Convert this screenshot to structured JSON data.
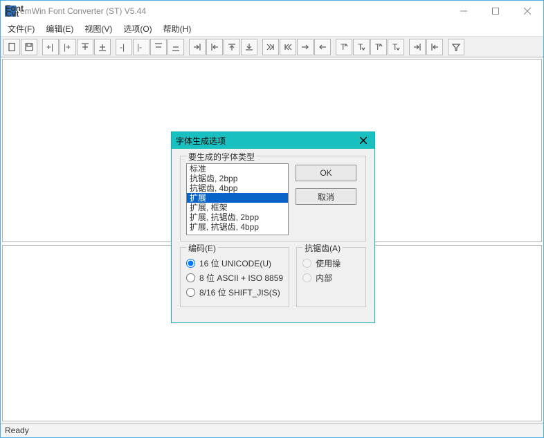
{
  "window": {
    "title": "emWin Font Converter (ST) V5.44",
    "appicon_top": "Font",
    "appicon_bot": "Cvt"
  },
  "menu": {
    "file": "文件(F)",
    "edit": "编辑(E)",
    "view": "视图(V)",
    "options": "选项(O)",
    "help": "帮助(H)"
  },
  "status": {
    "text": "Ready"
  },
  "dialog": {
    "title": "字体生成选项",
    "group_fonttype": "要生成的字体类型",
    "list": {
      "i0": "标准",
      "i1": "抗锯齿, 2bpp",
      "i2": "抗锯齿, 4bpp",
      "i3": "扩展",
      "i4": "扩展, 框架",
      "i5": "扩展, 抗锯齿, 2bpp",
      "i6": "扩展, 抗锯齿, 4bpp"
    },
    "selected_index": 3,
    "ok": "OK",
    "cancel": "取消",
    "group_encoding": "编码(E)",
    "enc_unicode": "16 位 UNICODE(U)",
    "enc_ascii": "8 位 ASCII + ISO 8859",
    "enc_sjis": "8/16 位 SHIFT_JIS(S)",
    "group_aa": "抗锯齿(A)",
    "aa_use": "使用操",
    "aa_internal": "内部"
  }
}
